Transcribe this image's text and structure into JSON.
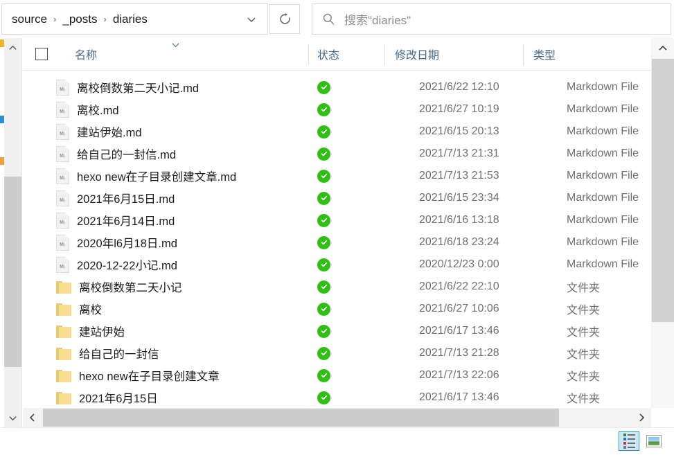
{
  "window": {
    "app": "file-explorer"
  },
  "address_bar": {
    "breadcrumbs": [
      "source",
      "_posts",
      "diaries"
    ],
    "separator": "›",
    "dropdown_icon": "chevron-down-icon",
    "refresh_icon": "refresh-icon"
  },
  "search": {
    "icon": "search-icon",
    "placeholder": "搜索\"diaries\"",
    "value": ""
  },
  "columns": {
    "name": "名称",
    "status": "状态",
    "date_modified": "修改日期",
    "type": "类型",
    "sort_indicator": "chevron-down-icon",
    "select_all_checked": false
  },
  "types": {
    "markdown": "Markdown File",
    "folder": "文件夹"
  },
  "files": [
    {
      "name": "离校倒数第二天小记.md",
      "icon": "markdown-file-icon",
      "status": "sync-complete-icon",
      "date": "2021/6/22 12:10",
      "type": "Markdown File"
    },
    {
      "name": "离校.md",
      "icon": "markdown-file-icon",
      "status": "sync-complete-icon",
      "date": "2021/6/27 10:19",
      "type": "Markdown File"
    },
    {
      "name": "建站伊始.md",
      "icon": "markdown-file-icon",
      "status": "sync-complete-icon",
      "date": "2021/6/15 20:13",
      "type": "Markdown File"
    },
    {
      "name": "给自己的一封信.md",
      "icon": "markdown-file-icon",
      "status": "sync-complete-icon",
      "date": "2021/7/13 21:31",
      "type": "Markdown File"
    },
    {
      "name": "hexo new在子目录创建文章.md",
      "icon": "markdown-file-icon",
      "status": "sync-complete-icon",
      "date": "2021/7/13 21:53",
      "type": "Markdown File"
    },
    {
      "name": "2021年6月15日.md",
      "icon": "markdown-file-icon",
      "status": "sync-complete-icon",
      "date": "2021/6/15 23:34",
      "type": "Markdown File"
    },
    {
      "name": "2021年6月14日.md",
      "icon": "markdown-file-icon",
      "status": "sync-complete-icon",
      "date": "2021/6/16 13:18",
      "type": "Markdown File"
    },
    {
      "name": "2020年l6月18日.md",
      "icon": "markdown-file-icon",
      "status": "sync-complete-icon",
      "date": "2021/6/18 23:24",
      "type": "Markdown File"
    },
    {
      "name": "2020-12-22小记.md",
      "icon": "markdown-file-icon",
      "status": "sync-complete-icon",
      "date": "2020/12/23 0:00",
      "type": "Markdown File"
    },
    {
      "name": "离校倒数第二天小记",
      "icon": "folder-icon",
      "status": "sync-complete-icon",
      "date": "2021/6/22 22:10",
      "type": "文件夹"
    },
    {
      "name": "离校",
      "icon": "folder-icon",
      "status": "sync-complete-icon",
      "date": "2021/6/27 10:06",
      "type": "文件夹"
    },
    {
      "name": "建站伊始",
      "icon": "folder-icon",
      "status": "sync-complete-icon",
      "date": "2021/6/17 13:46",
      "type": "文件夹"
    },
    {
      "name": "给自己的一封信",
      "icon": "folder-icon",
      "status": "sync-complete-icon",
      "date": "2021/7/13 21:28",
      "type": "文件夹"
    },
    {
      "name": "hexo new在子目录创建文章",
      "icon": "folder-icon",
      "status": "sync-complete-icon",
      "date": "2021/7/13 22:06",
      "type": "文件夹"
    },
    {
      "name": "2021年6月15日",
      "icon": "folder-icon",
      "status": "sync-complete-icon",
      "date": "2021/6/17 13:46",
      "type": "文件夹"
    }
  ],
  "scrollbars": {
    "vertical_up_icon": "chevron-up-icon",
    "vertical_down_icon": "chevron-down-icon",
    "horizontal_left_icon": "chevron-left-icon",
    "horizontal_right_icon": "chevron-right-icon"
  },
  "status_bar": {
    "view_details_icon": "details-view-icon",
    "view_details_selected": true,
    "view_thumbnails_icon": "large-icons-view-icon",
    "view_thumbnails_selected": false
  },
  "colors": {
    "header_text": "#45688f",
    "sync_green": "#2ec113",
    "folder_yellow": "#f7dd8f",
    "selected_view": "#cfe8f9"
  }
}
